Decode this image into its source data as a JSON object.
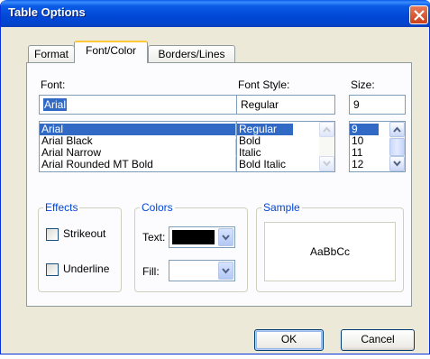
{
  "window": {
    "title": "Table Options"
  },
  "tabs": [
    {
      "label": "Format",
      "active": false
    },
    {
      "label": "Font/Color",
      "active": true
    },
    {
      "label": "Borders/Lines",
      "active": false
    }
  ],
  "font": {
    "label": "Font:",
    "value": "Arial",
    "options": [
      "Arial",
      "Arial Black",
      "Arial Narrow",
      "Arial Rounded MT Bold"
    ],
    "selected": "Arial"
  },
  "font_style": {
    "label": "Font Style:",
    "value": "Regular",
    "options": [
      "Regular",
      "Bold",
      "Italic",
      "Bold Italic"
    ],
    "selected": "Regular"
  },
  "size": {
    "label": "Size:",
    "value": "9",
    "options": [
      "9",
      "10",
      "11",
      "12"
    ],
    "selected": "9"
  },
  "effects": {
    "title": "Effects",
    "strikeout_label": "Strikeout",
    "strikeout_checked": false,
    "underline_label": "Underline",
    "underline_checked": false
  },
  "colors": {
    "title": "Colors",
    "text_label": "Text:",
    "text_color": "#000000",
    "fill_label": "Fill:",
    "fill_color": "#FFFFFF"
  },
  "sample": {
    "title": "Sample",
    "text": "AaBbCc"
  },
  "buttons": {
    "ok_label": "OK",
    "cancel_label": "Cancel"
  },
  "theme": {
    "accent": "#0046D5",
    "selection": "#316AC5",
    "dialog_bg": "#ECE9D8",
    "icons": [
      "close-icon",
      "scroll-up-icon",
      "scroll-down-icon",
      "dropdown-arrow-icon"
    ]
  }
}
